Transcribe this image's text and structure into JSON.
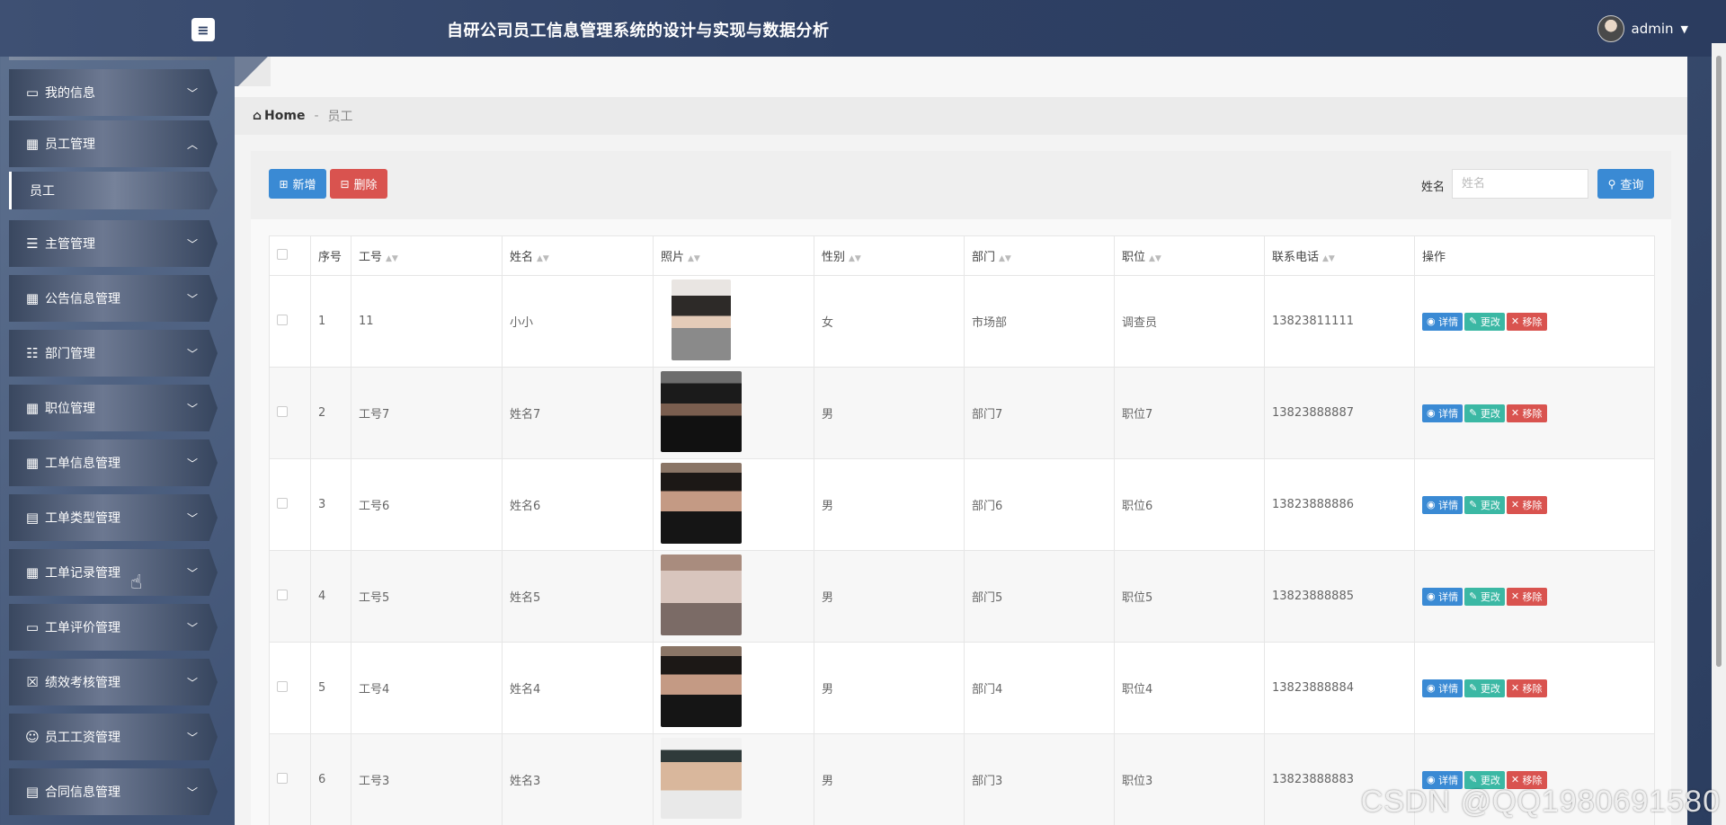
{
  "header": {
    "menu_toggle_icon": "menu-toggle-icon",
    "title": "自研公司员工信息管理系统的设计与实现与数据分析",
    "user": "admin"
  },
  "sidebar": {
    "items": [
      {
        "label": "我的信息",
        "icon": "▭"
      },
      {
        "label": "员工管理",
        "icon": "▦",
        "expanded": true
      },
      {
        "label": "主管管理",
        "icon": "☰"
      },
      {
        "label": "公告信息管理",
        "icon": "▦"
      },
      {
        "label": "部门管理",
        "icon": "☷"
      },
      {
        "label": "职位管理",
        "icon": "▦"
      },
      {
        "label": "工单信息管理",
        "icon": "▦"
      },
      {
        "label": "工单类型管理",
        "icon": "▤"
      },
      {
        "label": "工单记录管理",
        "icon": "▦"
      },
      {
        "label": "工单评价管理",
        "icon": "▭"
      },
      {
        "label": "绩效考核管理",
        "icon": "☒"
      },
      {
        "label": "员工工资管理",
        "icon": "☺"
      },
      {
        "label": "合同信息管理",
        "icon": "▤"
      }
    ],
    "sub_item": "员工"
  },
  "breadcrumb": {
    "home": "Home",
    "separator": "-",
    "current": "员工"
  },
  "toolbar": {
    "add_label": "新增",
    "delete_label": "删除",
    "search_label": "姓名",
    "search_placeholder": "姓名",
    "search_button": "查询"
  },
  "table": {
    "headers": [
      "序号",
      "工号",
      "姓名",
      "照片",
      "性别",
      "部门",
      "职位",
      "联系电话",
      "操作"
    ],
    "actions": {
      "detail": "详情",
      "edit": "更改",
      "remove": "移除"
    },
    "rows": [
      {
        "no": "1",
        "emp_id": "11",
        "name": "小小",
        "gender": "女",
        "dept": "市场部",
        "position": "调查员",
        "phone": "13823811111"
      },
      {
        "no": "2",
        "emp_id": "工号7",
        "name": "姓名7",
        "gender": "男",
        "dept": "部门7",
        "position": "职位7",
        "phone": "13823888887"
      },
      {
        "no": "3",
        "emp_id": "工号6",
        "name": "姓名6",
        "gender": "男",
        "dept": "部门6",
        "position": "职位6",
        "phone": "13823888886"
      },
      {
        "no": "4",
        "emp_id": "工号5",
        "name": "姓名5",
        "gender": "男",
        "dept": "部门5",
        "position": "职位5",
        "phone": "13823888885"
      },
      {
        "no": "5",
        "emp_id": "工号4",
        "name": "姓名4",
        "gender": "男",
        "dept": "部门4",
        "position": "职位4",
        "phone": "13823888884"
      },
      {
        "no": "6",
        "emp_id": "工号3",
        "name": "姓名3",
        "gender": "男",
        "dept": "部门3",
        "position": "职位3",
        "phone": "13823888883"
      }
    ]
  },
  "watermark": "CSDN @QQ1980691580",
  "colors": {
    "primary": "#3a8ad4",
    "danger": "#d9534f",
    "success": "#3bb8a4",
    "header_bg": "#2e4064"
  }
}
